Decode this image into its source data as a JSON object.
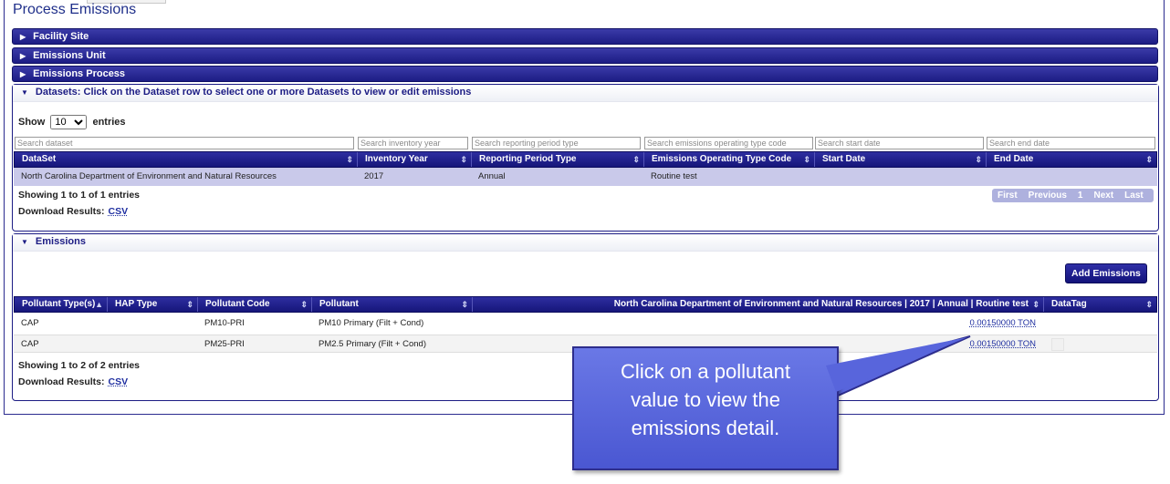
{
  "page_title": "Process Emissions",
  "sections": {
    "facility_site": "Facility Site",
    "emissions_unit": "Emissions Unit",
    "emissions_process": "Emissions Process"
  },
  "datasets": {
    "header": "Datasets: Click on the Dataset row to select one or more Datasets to view or edit emissions",
    "show_label": "Show",
    "show_value": "10",
    "entries_label": "entries",
    "search_placeholders": [
      "Search dataset",
      "Search inventory year",
      "Search reporting period type",
      "Search emissions operating type code",
      "Search start date",
      "Search end date"
    ],
    "columns": [
      "DataSet",
      "Inventory Year",
      "Reporting Period Type",
      "Emissions Operating Type Code",
      "Start Date",
      "End Date"
    ],
    "rows": [
      [
        "North Carolina Department of Environment and Natural Resources",
        "2017",
        "Annual",
        "Routine test",
        "",
        ""
      ]
    ],
    "info": "Showing 1 to 1 of 1 entries",
    "download_label": "Download Results:",
    "download_link": "CSV",
    "pager": [
      "First",
      "Previous",
      "1",
      "Next",
      "Last"
    ]
  },
  "emissions": {
    "header": "Emissions",
    "add_button": "Add Emissions",
    "columns": [
      "Pollutant Type(s)",
      "HAP Type",
      "Pollutant Code",
      "Pollutant",
      "North Carolina Department of Environment and Natural Resources | 2017 | Annual | Routine test",
      "DataTag"
    ],
    "rows": [
      [
        "CAP",
        "",
        "PM10-PRI",
        "PM10 Primary (Filt + Cond)",
        "0.00150000 TON",
        ""
      ],
      [
        "CAP",
        "",
        "PM25-PRI",
        "PM2.5 Primary (Filt + Cond)",
        "0.00150000 TON",
        ""
      ]
    ],
    "info": "Showing 1 to 2 of 2 entries",
    "download_label": "Download Results:",
    "download_link": "CSV"
  },
  "callout": {
    "lines": [
      "Click on a pollutant",
      "value to view the",
      "emissions detail."
    ]
  },
  "icons": {
    "collapsed": "triangle-right-icon",
    "expanded": "triangle-down-icon",
    "sort": "sort-arrows-icon",
    "sort_asc": "sort-up-icon"
  },
  "colors": {
    "bar": "#1c1c84",
    "accent_text": "#1f2f8a",
    "selected_row": "#c9c9ea",
    "callout": "#5865dc"
  }
}
